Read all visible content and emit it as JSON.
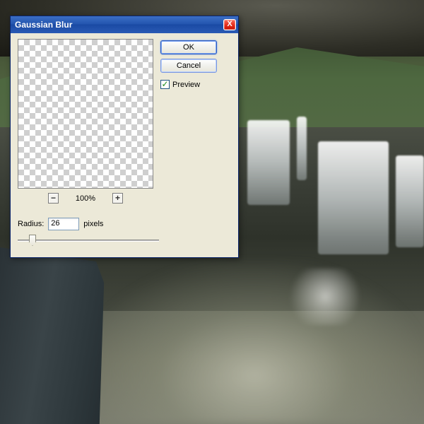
{
  "dialog": {
    "title": "Gaussian Blur",
    "ok_label": "OK",
    "cancel_label": "Cancel",
    "preview_label": "Preview",
    "preview_checked": true,
    "zoom": {
      "minus": "−",
      "plus": "+",
      "value": "100%"
    },
    "radius": {
      "label": "Radius:",
      "value": "26",
      "unit": "pixels"
    }
  },
  "icons": {
    "close": "X",
    "check": "✓"
  }
}
